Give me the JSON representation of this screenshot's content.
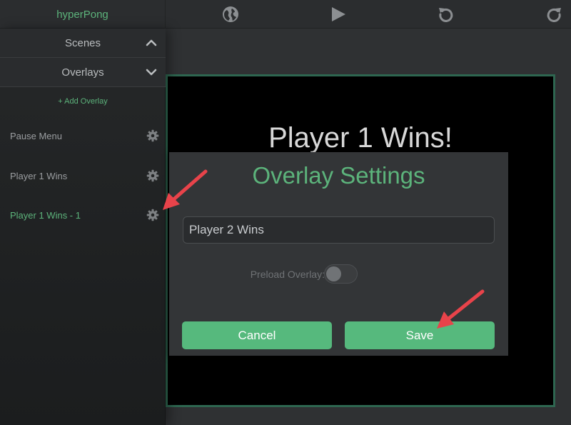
{
  "app": {
    "title": "hyperPong"
  },
  "toolbar": {
    "icons": [
      "globe-icon",
      "play-icon",
      "undo-icon",
      "redo-icon"
    ]
  },
  "sidebar": {
    "scenes_label": "Scenes",
    "overlays_label": "Overlays",
    "add_overlay_label": "+ Add Overlay",
    "overlays": [
      {
        "name": "Pause Menu",
        "active": false
      },
      {
        "name": "Player 1 Wins",
        "active": false
      },
      {
        "name": "Player 1 Wins - 1",
        "active": true
      }
    ]
  },
  "canvas": {
    "title": "Player 1 Wins!"
  },
  "modal": {
    "title": "Overlay Settings",
    "name_value": "Player 2 Wins",
    "preload_label": "Preload Overlay:",
    "preload_enabled": false,
    "cancel_label": "Cancel",
    "save_label": "Save"
  },
  "colors": {
    "accent": "#56b97d",
    "annotation_arrow": "#e8434a"
  }
}
